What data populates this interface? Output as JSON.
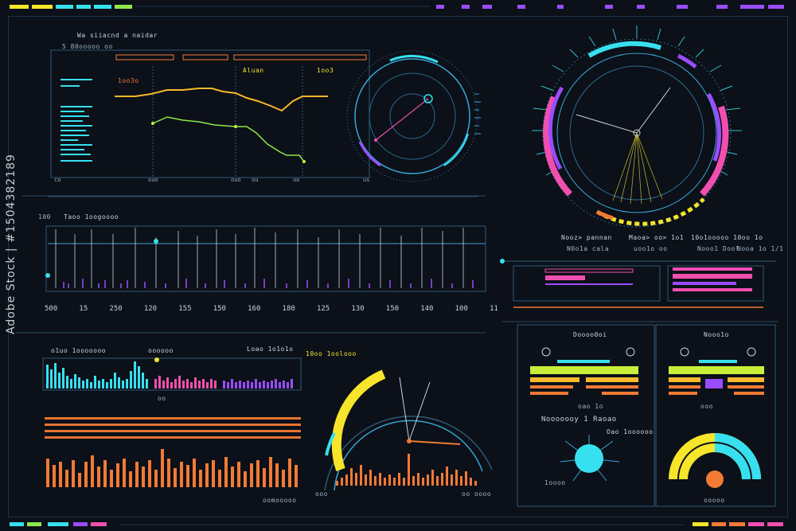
{
  "colors": {
    "bg": "#0c1018",
    "cyan": "#37e0ef",
    "yellow": "#f6e52b",
    "orange": "#f27a35",
    "magenta": "#f04fb0",
    "purple": "#9a4dff",
    "green": "#8ee84a",
    "lime": "#c7ef3a"
  },
  "watermark": "Adobe Stock | #1504382189",
  "panels": {
    "line_chart": {
      "title": "Wa⁠ ⁠siiacnd ⁠a ⁠naidar",
      "subtitle": "5 80ooooo oo",
      "label_a": "1oo3o",
      "label_b": "Aluan",
      "label_c": "1oo3",
      "x_ticks": [
        "co",
        "ouo",
        "ouo",
        "ou",
        "uo",
        "us"
      ]
    },
    "wave": {
      "title": "Taoo 1oogoooo",
      "label_left": "100",
      "axis": [
        "500",
        "15",
        "250",
        "120",
        "155",
        "150",
        "160",
        "180",
        "125",
        "130",
        "150",
        "140",
        "100",
        "11"
      ]
    },
    "right_stats": {
      "labels": [
        "Nooz> pannan",
        "Maoa> oo> 1o1",
        "10o1ooooo 10oo 1o"
      ],
      "sublabels": [
        "N0o1a  cala",
        "uoo1o oo",
        "Nooo1 Dool",
        "Nooa 1o 1/1"
      ]
    },
    "bars_panel": {
      "labels": [
        "o1uo 1ooooooo",
        "oooooo",
        "Loao 1o1o1o",
        "oo"
      ],
      "footer": "oomooooo"
    },
    "gauge_bottom": {
      "label": "10oo 1oolooo",
      "footer_left": "ooo",
      "footer_right": "oo  oooo"
    },
    "right_bottom": {
      "title_a": "Doooo0oi",
      "title_b": "Nooo1o",
      "heading": "Nooooooy  1  Raoao",
      "heading_b": "Oao 1oooooo",
      "note_a": "oao 1o",
      "note_b": "ooo",
      "foot_a": "1oooo",
      "foot_b": "ooooo"
    }
  }
}
